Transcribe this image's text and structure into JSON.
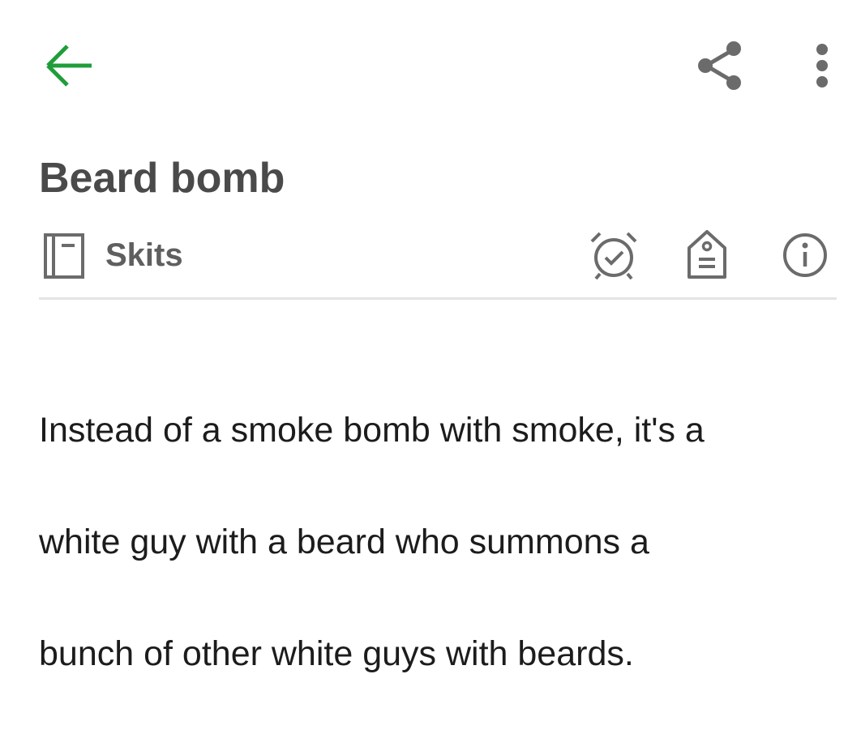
{
  "toolbar": {
    "back_icon": "arrow-left-icon",
    "share_icon": "share-icon",
    "more_icon": "more-vertical-icon",
    "accent_color": "#1f9d3a"
  },
  "note": {
    "title": "Beard bomb",
    "notebook": {
      "icon": "notebook-icon",
      "label": "Skits"
    },
    "actions": {
      "reminder_icon": "alarm-clock-icon",
      "tag_icon": "tag-icon",
      "info_icon": "info-icon"
    },
    "body_lines": [
      "Instead of a smoke bomb with smoke, it's a",
      "white guy with a beard who summons a",
      "bunch of other white guys with beards."
    ]
  }
}
